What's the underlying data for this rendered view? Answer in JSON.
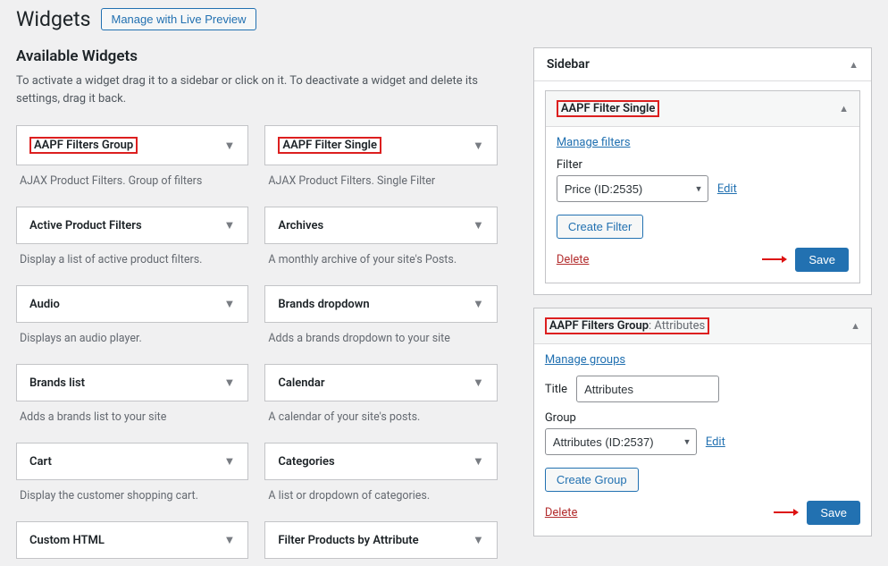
{
  "page": {
    "title": "Widgets",
    "preview_btn": "Manage with Live Preview"
  },
  "available": {
    "heading": "Available Widgets",
    "help": "To activate a widget drag it to a sidebar or click on it. To deactivate a widget and delete its settings, drag it back."
  },
  "widgets": [
    {
      "title": "AAPF Filters Group",
      "desc": "AJAX Product Filters. Group of filters",
      "hl": true
    },
    {
      "title": "AAPF Filter Single",
      "desc": "AJAX Product Filters. Single Filter",
      "hl": true
    },
    {
      "title": "Active Product Filters",
      "desc": "Display a list of active product filters."
    },
    {
      "title": "Archives",
      "desc": "A monthly archive of your site's Posts."
    },
    {
      "title": "Audio",
      "desc": "Displays an audio player."
    },
    {
      "title": "Brands dropdown",
      "desc": "Adds a brands dropdown to your site"
    },
    {
      "title": "Brands list",
      "desc": "Adds a brands list to your site"
    },
    {
      "title": "Calendar",
      "desc": "A calendar of your site's posts."
    },
    {
      "title": "Cart",
      "desc": "Display the customer shopping cart."
    },
    {
      "title": "Categories",
      "desc": "A list or dropdown of categories."
    },
    {
      "title": "Custom HTML",
      "desc": ""
    },
    {
      "title": "Filter Products by Attribute",
      "desc": ""
    }
  ],
  "sidebar": {
    "title": "Sidebar",
    "panel1": {
      "title": "AAPF Filter Single",
      "manage_link": "Manage filters",
      "filter_label": "Filter",
      "filter_value": "Price (ID:2535)",
      "edit_link": "Edit",
      "create_btn": "Create Filter",
      "delete": "Delete",
      "save": "Save"
    },
    "panel2": {
      "title": "AAPF Filters Group",
      "title_suffix": ": Attributes",
      "manage_link": "Manage groups",
      "title_label": "Title",
      "title_value": "Attributes",
      "group_label": "Group",
      "group_value": "Attributes (ID:2537)",
      "edit_link": "Edit",
      "create_btn": "Create Group",
      "delete": "Delete",
      "save": "Save"
    }
  }
}
